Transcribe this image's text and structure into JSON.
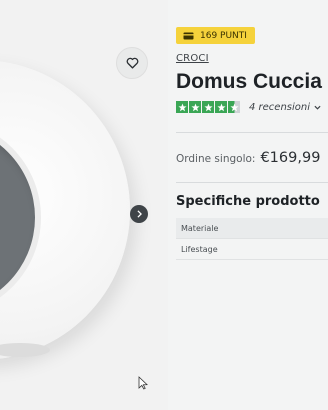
{
  "badge": {
    "points": "169 PUNTI",
    "icon": "card-icon",
    "color": "#f5d23b"
  },
  "product": {
    "brand": "CROCI",
    "title": "Domus Cuccia p",
    "rating": {
      "stars": 4.5,
      "reviews": "4 recensioni"
    },
    "price_label": "Ordine singolo:",
    "price": "€169,99"
  },
  "specs": {
    "title": "Specifiche prodotto",
    "rows": [
      "Materiale",
      "Lifestage"
    ]
  },
  "icons": {
    "wishlist": "heart-icon",
    "next": "chevron-right-icon",
    "reviews": "chevron-down-icon"
  },
  "colors": {
    "rating_green": "#3aa655",
    "badge_yellow": "#f5d23b"
  }
}
